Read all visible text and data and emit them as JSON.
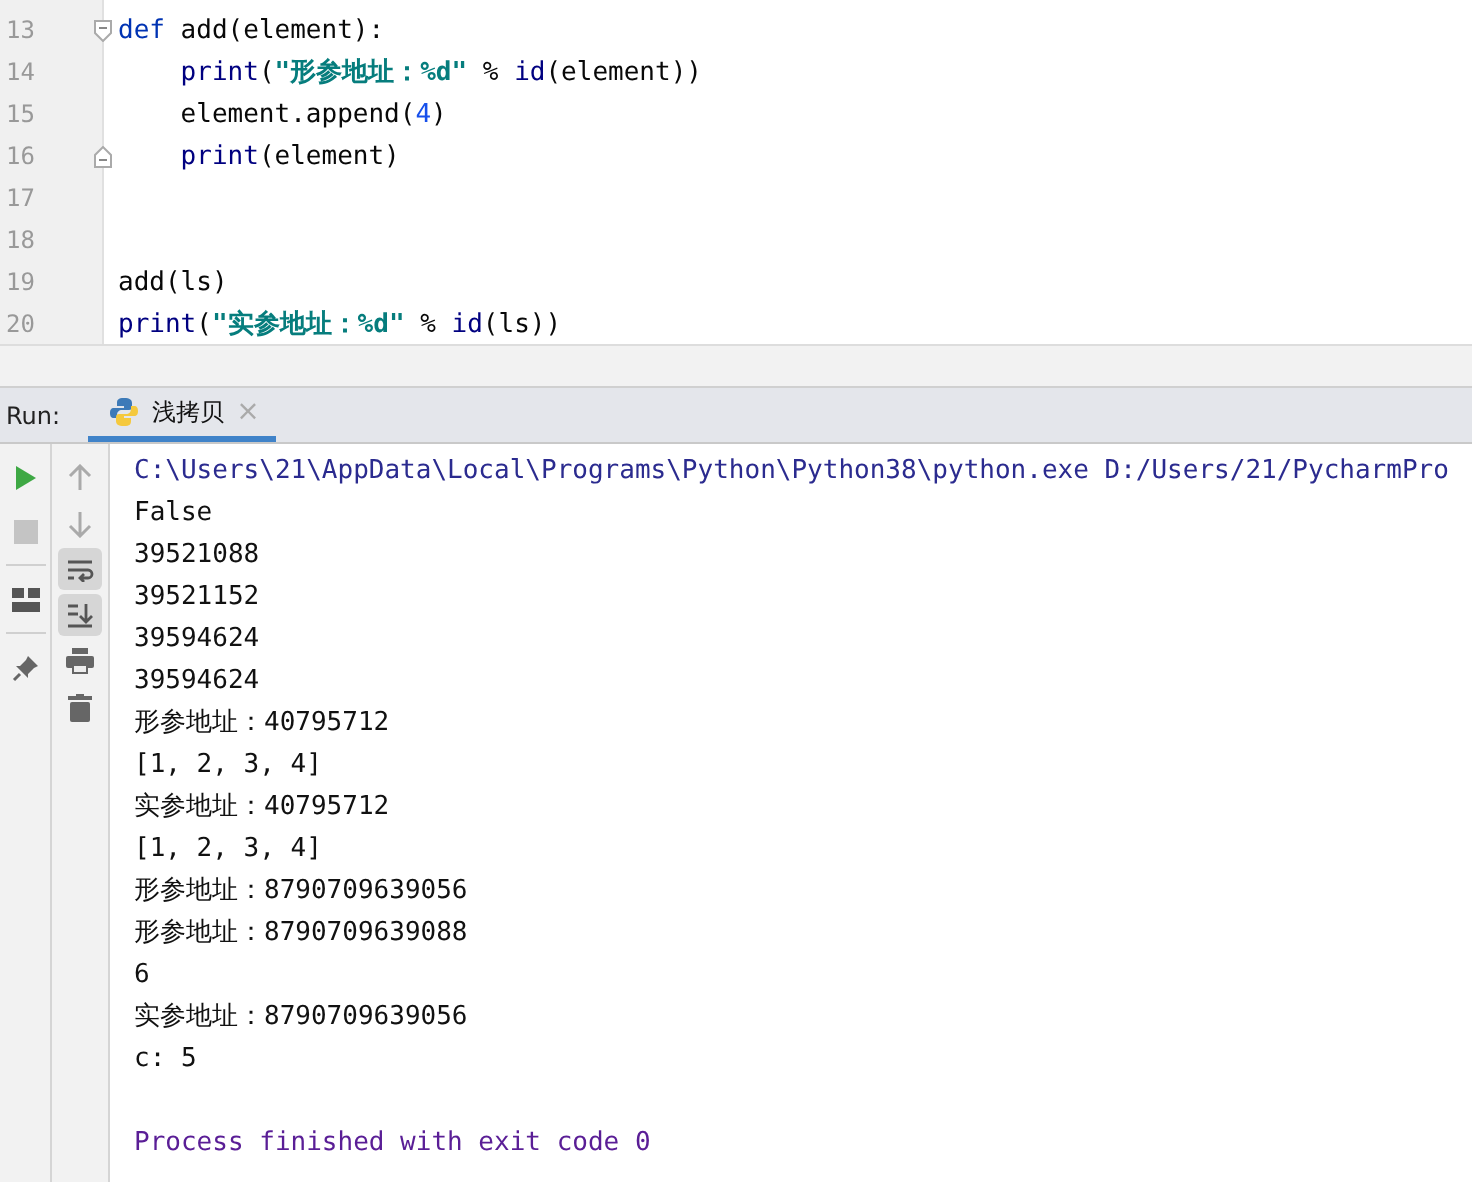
{
  "editor": {
    "lines": [
      {
        "number": "13",
        "tokens": [
          {
            "text": "def",
            "kind": "keyword"
          },
          {
            "text": " add(element):",
            "kind": "plain"
          }
        ],
        "children": [
          {
            "number": "14",
            "tokens": [
              {
                "text": "print",
                "kind": "builtin"
              },
              {
                "text": "(",
                "kind": "plain"
              },
              {
                "text": "\"形参地址：%d\"",
                "kind": "string"
              },
              {
                "text": " % ",
                "kind": "plain"
              },
              {
                "text": "id",
                "kind": "builtin"
              },
              {
                "text": "(element))",
                "kind": "plain"
              }
            ]
          },
          {
            "number": "15",
            "tokens": [
              {
                "text": "element.append(",
                "kind": "plain"
              },
              {
                "text": "4",
                "kind": "number"
              },
              {
                "text": ")",
                "kind": "plain"
              }
            ]
          },
          {
            "number": "16",
            "tokens": [
              {
                "text": "print",
                "kind": "builtin"
              },
              {
                "text": "(element)",
                "kind": "plain"
              }
            ]
          }
        ]
      },
      {
        "number": "17"
      },
      {
        "number": "18"
      },
      {
        "number": "19",
        "tokens": [
          {
            "text": "add(ls)",
            "kind": "plain"
          }
        ]
      },
      {
        "number": "20",
        "tokens": [
          {
            "text": "print",
            "kind": "builtin"
          },
          {
            "text": "(",
            "kind": "plain"
          },
          {
            "text": "\"实参地址：%d\"",
            "kind": "string"
          },
          {
            "text": " % ",
            "kind": "plain"
          },
          {
            "text": "id",
            "kind": "builtin"
          },
          {
            "text": "(ls))",
            "kind": "plain"
          }
        ]
      }
    ]
  },
  "run_panel": {
    "label": "Run:",
    "tabs": [
      {
        "title": "浅拷贝",
        "selected": true,
        "close": "×"
      }
    ],
    "left_toolbar": [
      {
        "kind": "run"
      },
      {
        "kind": "stop"
      },
      {
        "kind": "layout"
      },
      {
        "kind": "pin"
      }
    ],
    "console_toolbar": [
      {
        "kind": "up",
        "on": false
      },
      {
        "kind": "down",
        "on": false
      },
      {
        "kind": "wrap",
        "on": true
      },
      {
        "kind": "scroll-end",
        "on": true
      },
      {
        "kind": "print",
        "on": false
      },
      {
        "kind": "trash",
        "on": false
      }
    ],
    "output": [
      {
        "text": "C:\\Users\\21\\AppData\\Local\\Programs\\Python\\Python38\\python.exe D:/Users/21/PycharmPro",
        "kind": "command"
      },
      {
        "text": "False",
        "kind": "plain"
      },
      {
        "text": "39521088",
        "kind": "plain"
      },
      {
        "text": "39521152",
        "kind": "plain"
      },
      {
        "text": "39594624",
        "kind": "plain"
      },
      {
        "text": "39594624",
        "kind": "plain"
      },
      {
        "text": "形参地址：40795712",
        "kind": "plain"
      },
      {
        "text": "[1, 2, 3, 4]",
        "kind": "plain"
      },
      {
        "text": "实参地址：40795712",
        "kind": "plain"
      },
      {
        "text": "[1, 2, 3, 4]",
        "kind": "plain"
      },
      {
        "text": "形参地址：8790709639056",
        "kind": "plain"
      },
      {
        "text": "形参地址：8790709639088",
        "kind": "plain"
      },
      {
        "text": "6",
        "kind": "plain"
      },
      {
        "text": "实参地址：8790709639056",
        "kind": "plain"
      },
      {
        "text": "c: 5",
        "kind": "plain"
      },
      {
        "kind": "blank"
      },
      {
        "text": "Process finished with exit code 0",
        "kind": "exit"
      }
    ]
  }
}
